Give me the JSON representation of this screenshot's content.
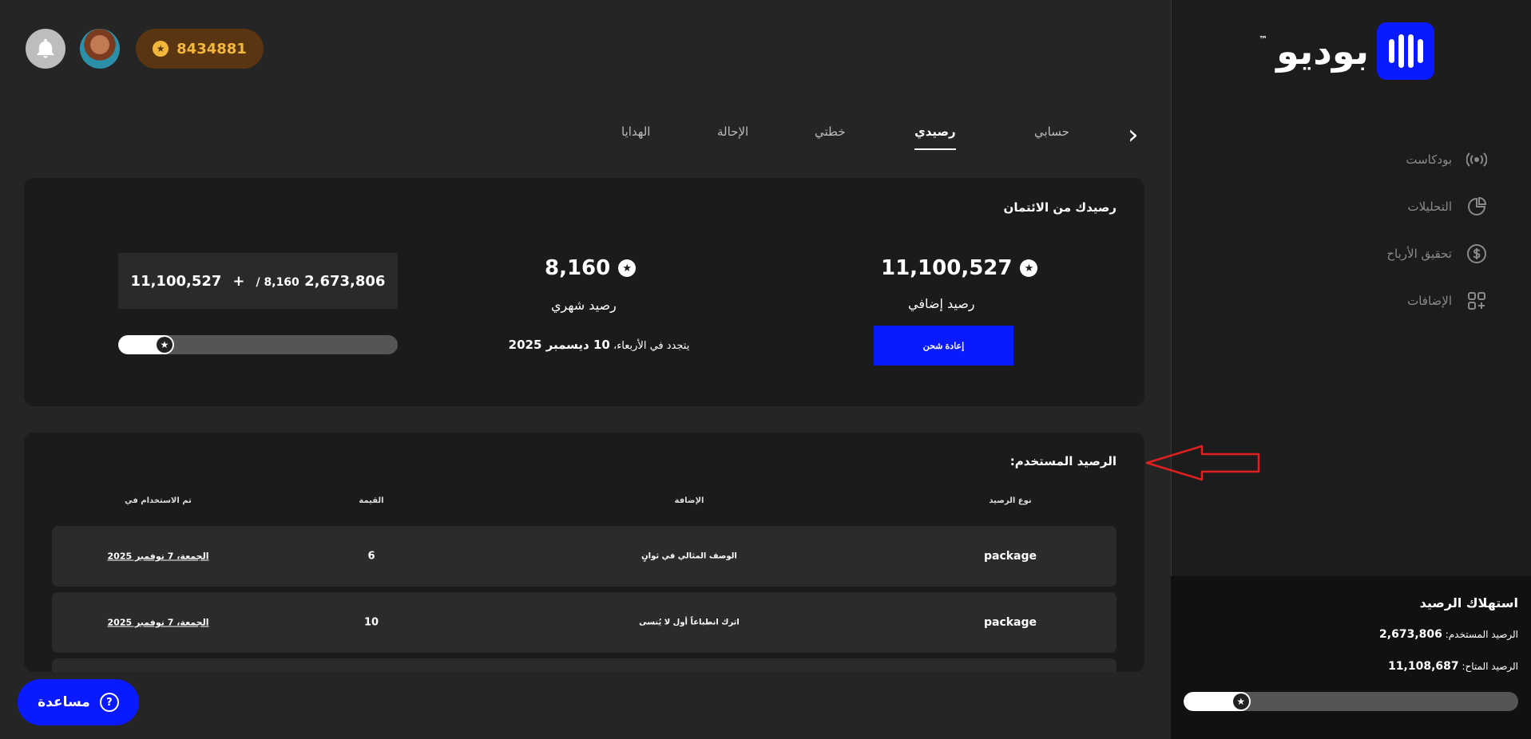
{
  "brand": {
    "name": "بوديو",
    "tm": "™"
  },
  "sidebar": {
    "items": [
      {
        "label": "بودكاست",
        "icon": "podcast-icon"
      },
      {
        "label": "التحليلات",
        "icon": "pie-chart-icon"
      },
      {
        "label": "تحقيق الأرباح",
        "icon": "dollar-icon"
      },
      {
        "label": "الإضافات",
        "icon": "addons-icon"
      }
    ],
    "consumption": {
      "title": "استهلاك الرصيد",
      "used_label": "الرصيد المستخدم:",
      "used_value": "2,673,806",
      "available_label": "الرصيد المتاح:",
      "available_value": "11,108,687",
      "progress_fraction": 0.2
    }
  },
  "topbar": {
    "coins": "8434881"
  },
  "tabs": [
    {
      "label": "حسابي"
    },
    {
      "label": "رصيدي"
    },
    {
      "label": "خطتي"
    },
    {
      "label": "الإحالة"
    },
    {
      "label": "الهدايا"
    }
  ],
  "credit": {
    "title": "رصيدك من الائتمان",
    "extra_value": "11,100,527",
    "extra_label": "رصيد إضافي",
    "recharge_label": "إعادة شحن",
    "monthly_value": "8,160",
    "monthly_label": "رصيد شهري",
    "renew_text": "يتجدد في الأربعاء، ",
    "renew_date": "10 ديسمبر 2025",
    "sum_used": "2,673,806",
    "sum_monthly": "/ 8,160",
    "sum_plus": "+",
    "sum_extra": "11,100,527",
    "progress_fraction": 0.2
  },
  "used": {
    "title": "الرصيد المستخدم:",
    "columns": [
      "نوع الرصيد",
      "الإضافة",
      "القيمة",
      "تم الاستخدام في"
    ],
    "rows": [
      {
        "type": "package",
        "addon": "الوصف المثالي في ثوانٍ",
        "value": "6",
        "date": "الجمعة، 7 نوفمبر 2025"
      },
      {
        "type": "package",
        "addon": "اترك انطباعاً أول لا يُنسى",
        "value": "10",
        "date": "الجمعة، 7 نوفمبر 2025"
      }
    ]
  },
  "help": {
    "label": "مساعدة"
  }
}
